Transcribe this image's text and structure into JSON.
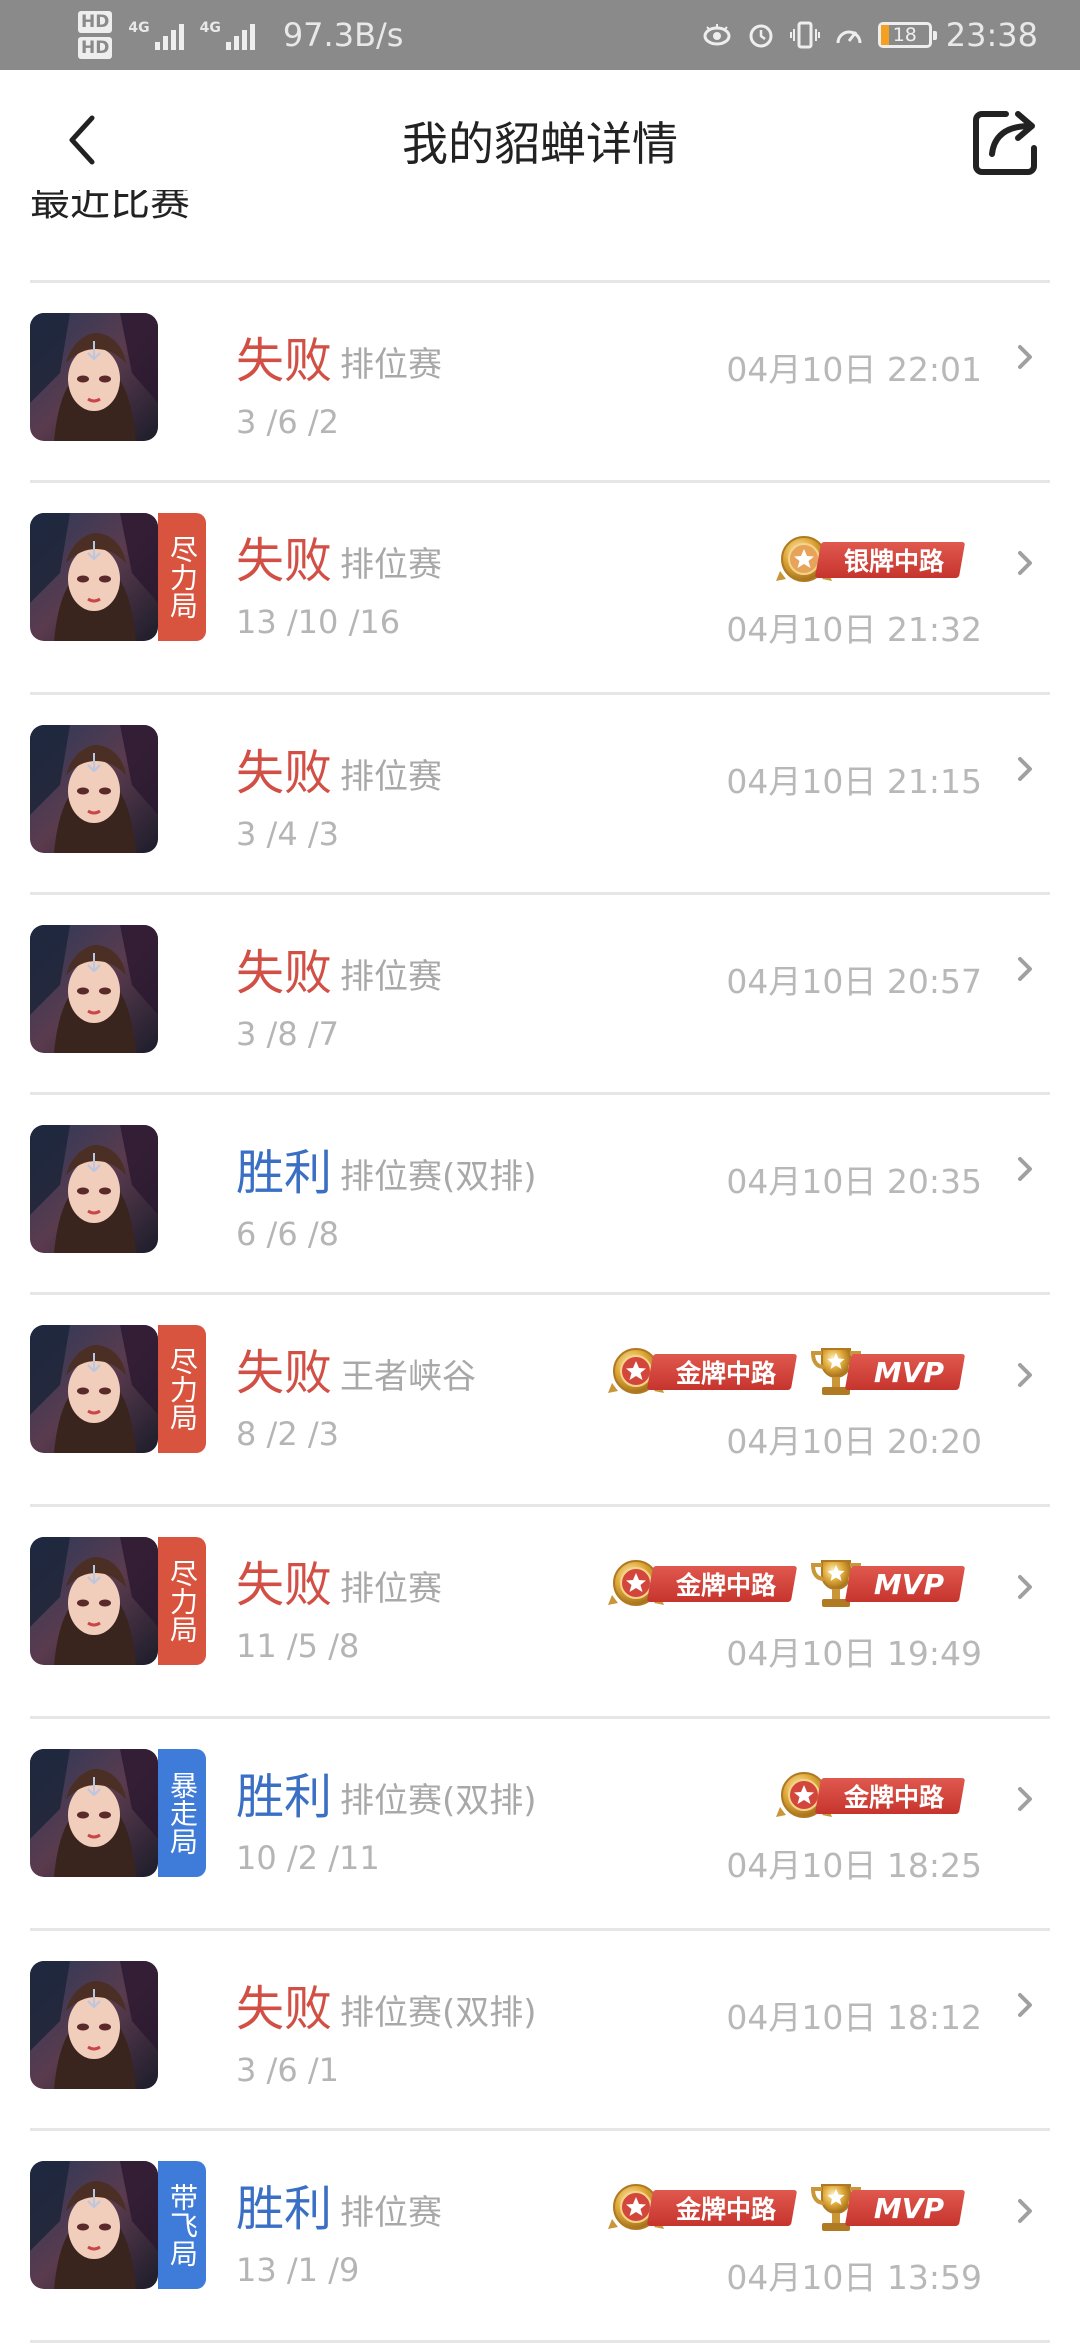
{
  "status_bar": {
    "speed": "97.3B/s",
    "battery": "18",
    "time": "23:38",
    "hd1": "HD",
    "hd2": "HD",
    "net1": "4G",
    "net2": "4G"
  },
  "header": {
    "title": "我的貂蝉详情"
  },
  "section": {
    "title": "最近比赛"
  },
  "colors": {
    "lose": "#d24f45",
    "win": "#3a6fc4",
    "tag_red": "#d9543f",
    "tag_blue": "#3f7bd9",
    "divider": "#e6e6e6"
  },
  "matches": [
    {
      "result": "失败",
      "mode": "排位赛",
      "kda": "3 /6 /2",
      "time": "04月10日 22:01"
    },
    {
      "result": "失败",
      "mode": "排位赛",
      "kda": "13 /10 /16",
      "time": "04月10日 21:32",
      "tag": "尽力局",
      "badges": [
        "银牌中路"
      ]
    },
    {
      "result": "失败",
      "mode": "排位赛",
      "kda": "3 /4 /3",
      "time": "04月10日 21:15"
    },
    {
      "result": "失败",
      "mode": "排位赛",
      "kda": "3 /8 /7",
      "time": "04月10日 20:57"
    },
    {
      "result": "胜利",
      "mode": "排位赛(双排)",
      "kda": "6 /6 /8",
      "time": "04月10日 20:35"
    },
    {
      "result": "失败",
      "mode": "王者峡谷",
      "kda": "8 /2 /3",
      "time": "04月10日 20:20",
      "tag": "尽力局",
      "badges": [
        "金牌中路",
        "MVP"
      ]
    },
    {
      "result": "失败",
      "mode": "排位赛",
      "kda": "11 /5 /8",
      "time": "04月10日 19:49",
      "tag": "尽力局",
      "badges": [
        "金牌中路",
        "MVP"
      ]
    },
    {
      "result": "胜利",
      "mode": "排位赛(双排)",
      "kda": "10 /2 /11",
      "time": "04月10日 18:25",
      "tag": "暴走局",
      "badges": [
        "金牌中路"
      ]
    },
    {
      "result": "失败",
      "mode": "排位赛(双排)",
      "kda": "3 /6 /1",
      "time": "04月10日 18:12"
    },
    {
      "result": "胜利",
      "mode": "排位赛",
      "kda": "13 /1 /9",
      "time": "04月10日 13:59",
      "tag": "带飞局",
      "badges": [
        "金牌中路",
        "MVP"
      ]
    }
  ]
}
